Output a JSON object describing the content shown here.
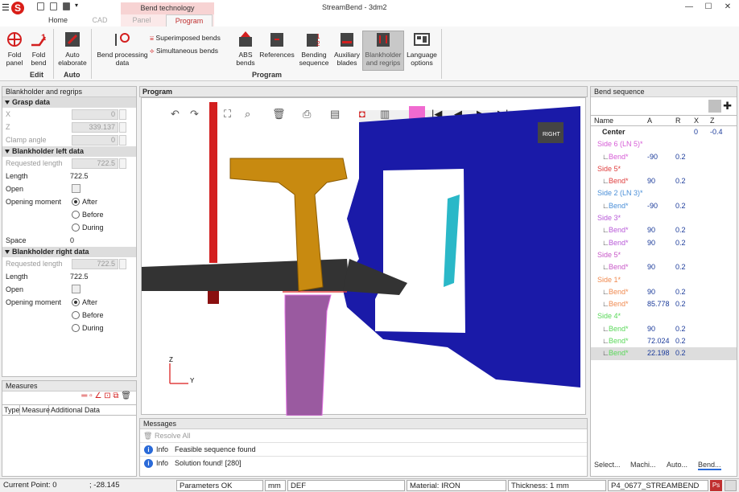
{
  "app": {
    "title": "StreamBend - 3dm2",
    "logo_text": "S"
  },
  "tabs": {
    "home": "Home",
    "cad": "CAD",
    "panel": "Panel",
    "program": "Program",
    "context_group": "Bend technology"
  },
  "ribbon": {
    "fold_panel": "Fold panel",
    "fold_bend": "Fold bend",
    "auto_elaborate": "Auto elaborate",
    "bend_processing": "Bend processing data",
    "superimposed": "Superimposed bends",
    "simultaneous": "Simultaneous bends",
    "abs_bends": "ABS bends",
    "references": "References",
    "bending_sequence": "Bending sequence",
    "auxiliary_blades": "Auxiliary blades",
    "blankholder": "Blankholder and regrips",
    "language": "Language options",
    "group_edit": "Edit",
    "group_auto": "Auto",
    "group_program": "Program"
  },
  "left": {
    "title": "Blankholder and regrips",
    "grasp": {
      "title": "Grasp data",
      "x_label": "X",
      "x_value": "0",
      "z_label": "Z",
      "z_value": "339.137",
      "clamp_label": "Clamp angle",
      "clamp_value": "0"
    },
    "left_bh": {
      "title": "Blankholder left data",
      "req_label": "Requested length",
      "req_value": "722.5",
      "length_label": "Length",
      "length_value": "722.5",
      "open_label": "Open",
      "moment_label": "Opening moment",
      "after": "After",
      "before": "Before",
      "during": "During",
      "space_label": "Space",
      "space_value": "0"
    },
    "right_bh": {
      "title": "Blankholder right data",
      "req_label": "Requested length",
      "req_value": "722.5",
      "length_label": "Length",
      "length_value": "722.5",
      "open_label": "Open",
      "moment_label": "Opening moment",
      "after": "After",
      "before": "Before",
      "during": "During"
    }
  },
  "measures": {
    "title": "Measures",
    "col_type": "Type",
    "col_measure": "Measure",
    "col_additional": "Additional Data"
  },
  "program": {
    "title": "Program",
    "view_label": "RIGHT",
    "axis_z": "Z",
    "axis_y": "Y"
  },
  "messages": {
    "title": "Messages",
    "resolve": "Resolve All",
    "items": [
      {
        "level": "Info",
        "text": "Feasible sequence found"
      },
      {
        "level": "Info",
        "text": "Solution found! [280]"
      }
    ]
  },
  "sequence": {
    "title": "Bend sequence",
    "cols": [
      "Name",
      "A",
      "R",
      "X",
      "Z"
    ],
    "rows": [
      {
        "name": "Center",
        "a": "",
        "r": "",
        "x": "0",
        "z": "-0.4",
        "kind": "center",
        "color": "#222"
      },
      {
        "name": "Side 6 (LN 5)*",
        "kind": "side",
        "color": "#d65bd6"
      },
      {
        "name": "Bend*",
        "a": "-90",
        "r": "0.2",
        "kind": "bend",
        "color": "#d65bd6"
      },
      {
        "name": "Side 5*",
        "kind": "side",
        "color": "#e04040"
      },
      {
        "name": "Bend*",
        "a": "90",
        "r": "0.2",
        "kind": "bend",
        "color": "#e04040"
      },
      {
        "name": "Side 2 (LN 3)*",
        "kind": "side",
        "color": "#4a8fd8"
      },
      {
        "name": "Bend*",
        "a": "-90",
        "r": "0.2",
        "kind": "bend",
        "color": "#4a8fd8"
      },
      {
        "name": "Side 3*",
        "kind": "side",
        "color": "#b85ad8"
      },
      {
        "name": "Bend*",
        "a": "90",
        "r": "0.2",
        "kind": "bend",
        "color": "#b85ad8"
      },
      {
        "name": "Bend*",
        "a": "90",
        "r": "0.2",
        "kind": "bend",
        "color": "#b85ad8"
      },
      {
        "name": "Side 5*",
        "kind": "side",
        "color": "#c858c8"
      },
      {
        "name": "Bend*",
        "a": "90",
        "r": "0.2",
        "kind": "bend",
        "color": "#c858c8"
      },
      {
        "name": "Side 1*",
        "kind": "side",
        "color": "#f08a50"
      },
      {
        "name": "Bend*",
        "a": "90",
        "r": "0.2",
        "kind": "bend",
        "color": "#f08a50"
      },
      {
        "name": "Bend*",
        "a": "85.778",
        "r": "0.2",
        "kind": "bend",
        "color": "#f08a50"
      },
      {
        "name": "Side 4*",
        "kind": "side",
        "color": "#5ad85a"
      },
      {
        "name": "Bend*",
        "a": "90",
        "r": "0.2",
        "kind": "bend",
        "color": "#5ad85a"
      },
      {
        "name": "Bend*",
        "a": "72.024",
        "r": "0.2",
        "kind": "bend",
        "color": "#5ad85a"
      },
      {
        "name": "Bend*",
        "a": "22.198",
        "r": "0.2",
        "kind": "bend",
        "color": "#5ad85a",
        "selected": true
      }
    ],
    "bottom_tabs": [
      "Select...",
      "Machi...",
      "Auto...",
      "Bend..."
    ]
  },
  "status": {
    "current_point": "Current Point: 0",
    "coord": "; -28.145",
    "params": "Parameters OK",
    "mm": "mm",
    "def": "DEF",
    "material": "Material: IRON",
    "thickness": "Thickness: 1 mm",
    "file": "P4_0677_STREAMBEND",
    "badge": "Ps"
  }
}
